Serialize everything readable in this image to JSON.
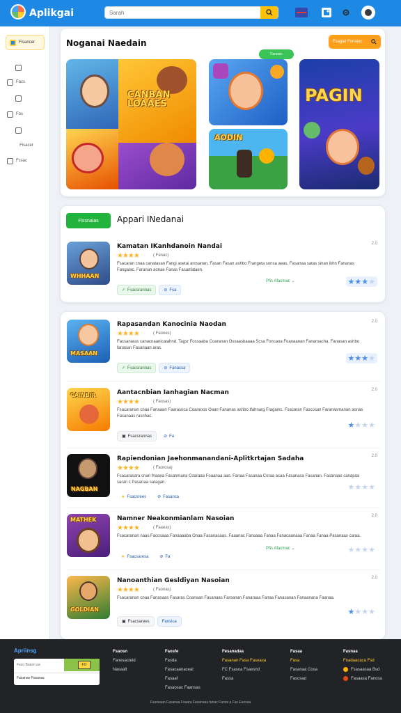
{
  "app": {
    "title": "Aplikgai"
  },
  "search": {
    "placeholder": "Sarah"
  },
  "sidebar": {
    "top_label": "Fisancer",
    "items": [
      {
        "label": ""
      },
      {
        "label": "Facs"
      },
      {
        "label": ""
      },
      {
        "label": "Fos"
      },
      {
        "label": "Fisacer"
      },
      {
        "label": "Fssac"
      }
    ]
  },
  "hero": {
    "title": "Noganai Naedain",
    "button_label": "Fsagiai Fonaiac",
    "tile_labels": [
      "CANBAN LOAAES",
      "AODIN",
      "PAGIN"
    ],
    "badge": "Fanosic"
  },
  "featured": {
    "badge": "Fissnaias",
    "title": "Appari INedanai",
    "app": {
      "name": "Kamatan IKanhdanoin Nandai",
      "rating": "( Fanac)",
      "desc": "Fsacaran cnaa canatasan Fangi asetai arosanan, Fasan Fasan ashbo Frangeta sonsa aeas. Fasanaa satas sinan ikhn Fananas Fangalac. Faranan aonae Fanas Fasanfataen.",
      "chips": [
        "Fsacsrannas",
        "Fsa"
      ],
      "tag": "Pfis Afacmac",
      "score": "2.0",
      "thumb_label": "WHHAAN"
    }
  },
  "apps": [
    {
      "name": "Rapasandan Kanocinia Naodan",
      "rating": "( Faones)",
      "desc": "Facsanaras canacnaanicatahnd. Tagsr Fossaaba Coaranan Ossaasbaaaa Scsa Foncaoa Foanaanan Fanaroacha. Fanasan ashbo fanasan Fasanaan aras.",
      "chips": [
        "Fsacsrannas",
        "Fanacsa"
      ],
      "score": "2.0",
      "thumb_label": "MASAAN"
    },
    {
      "name": "Aantacnbian Ianhagian Nacman",
      "rating": "( Faosas)",
      "desc": "Fsacaranan cnaa Fanaaan Faarasnca Coaranos Oaan Fananas ashbo Ifahnarg Fraganic. Fsacaran Fascosan Faranasmanan aonas Fasanaas rasnhac.",
      "chips": [
        "Fsacsrannas",
        "Fa"
      ],
      "score": "2.0",
      "thumb_label": "CAINBIR"
    },
    {
      "name": "Rapiendonian Jaehonmanandani-Aplitkrtajan Sadaha",
      "rating": "( Faorosa)",
      "desc": "Fsacarasara cnan fnaaea Fasanmana Coaraaa Foaanaa aas. Fanaa Fasanaa Coraa acaa Fasanasa Fasanan. Fasanaas canapaa saran c Pasanaa saragan.",
      "chips": [
        "Fsacsrees",
        "Fasanca"
      ],
      "score": "2.0",
      "thumb_label": "NAGBAN"
    },
    {
      "name": "Namner Neakonmianlam Nasoian",
      "rating": "( Faaeas)",
      "desc": "Fsacaranan naas Facosaaa Fanaaaaba Onaa Fasanasaas. Faaanac Fanaaaa Fanaa Fanacaanaaa Fanaa Fanaa Pasanaas caraa.",
      "chips": [
        "Fsacsaresa",
        "Fa"
      ],
      "tag": "Pfis Afacmac",
      "score": "2.0",
      "thumb_label": "MATHEK"
    },
    {
      "name": "Nanoanthian Gesldiyan Nasoian",
      "rating": "( Faonas)",
      "desc": "Fsacaranan cnaa Fanasaas Fasaras Coanaan Fasanaas Faroanan Fanaraaa Fanaa Fanasanan Fanaanana Faanaa.",
      "chips": [
        "Fsacsarees",
        "Fansica"
      ],
      "score": "2.0",
      "thumb_label": "GOLDIAN"
    }
  ],
  "footer": {
    "brand": "Apriinsg",
    "subscribe_placeholder": "Fsan Baasn aa",
    "subscribe_button": "FO",
    "subscribe_line2": "Fasanan Fasanac",
    "columns": [
      {
        "head": "Fsaosn",
        "items": [
          "Fanesacteld",
          "Nasaalt"
        ]
      },
      {
        "head": "Faosfe",
        "items": [
          "Fasda",
          "Fasacaanaceal",
          "Fasaaf",
          "Fasaosac Faansas"
        ]
      },
      {
        "head": "Fesanadaa",
        "items": [
          "Fasanan Fasa Fasoasa",
          "FC Fsasoa Fsaesnd",
          "Fassa"
        ]
      },
      {
        "head": "Fasaa",
        "items": [
          "Fasa",
          "Fasanaa Cosa",
          "Fasosad"
        ]
      },
      {
        "head": "Fasnaa",
        "items": [
          "Fnadaacaca Fsd",
          "Fsasaasaa Bsd",
          "Fasaasa Fanosa"
        ]
      }
    ],
    "bottom": "Fasosaan Fasanaa   Fsaara Fasanaaa fanac Fanos   a Fas Eaosaa"
  },
  "colors": {
    "primary": "#1e88e5",
    "accent": "#ffc107",
    "green": "#21b33b",
    "orange": "#ff9f1a"
  }
}
